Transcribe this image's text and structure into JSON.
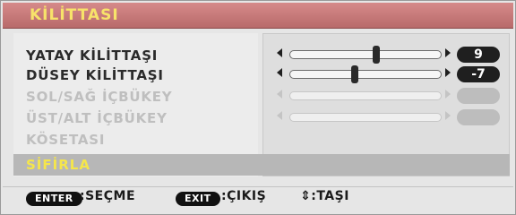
{
  "title": "KİLİTTASI",
  "items": [
    {
      "label": "YATAY KİLİTTAŞI",
      "value": "9",
      "level": 0.57,
      "enabled": true
    },
    {
      "label": "DÜSEY KİLİTTAŞI",
      "value": "-7",
      "level": 0.43,
      "enabled": true
    },
    {
      "label": "SOL/SAĞ İÇBÜKEY",
      "value": "",
      "level": 0,
      "enabled": false
    },
    {
      "label": "ÜST/ALT İÇBÜKEY",
      "value": "",
      "level": 0,
      "enabled": false
    },
    {
      "label": "KÖSETASI",
      "enabled": false
    }
  ],
  "selected_item": "SİFİRLA",
  "footer": {
    "enter_label": "ENTER",
    "enter_hint": ":SEÇME",
    "exit_label": "EXIT",
    "exit_hint": ":ÇIKIŞ",
    "move_hint": "⇕:TAŞI"
  }
}
